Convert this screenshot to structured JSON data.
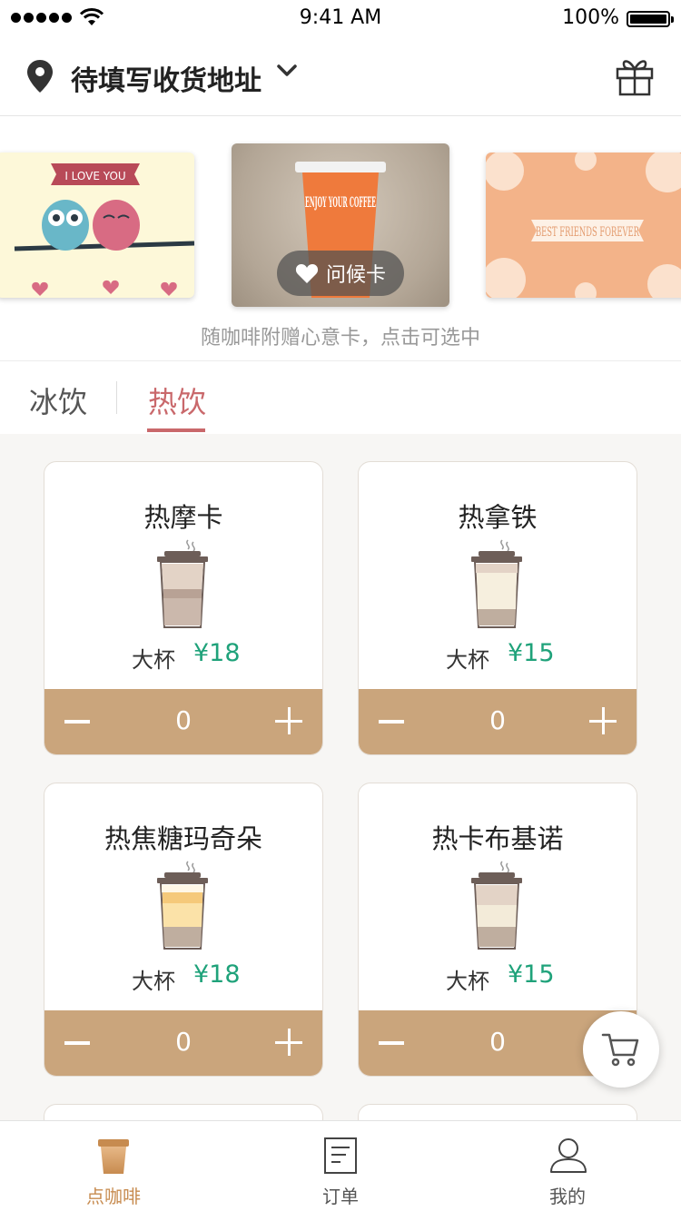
{
  "status_bar": {
    "time": "9:41 AM",
    "battery": "100%"
  },
  "header": {
    "address": "待填写收货地址"
  },
  "cards": {
    "items": [
      {
        "name": "owl-card",
        "text": "I LOVE YOU"
      },
      {
        "name": "coffee-card",
        "text": "ENJOY YOUR COFFEE",
        "badge": "问候卡"
      },
      {
        "name": "friends-card",
        "text": "BEST FRIENDS FOREVER"
      }
    ],
    "hint": "随咖啡附赠心意卡，点击可选中"
  },
  "tabs": {
    "items": [
      {
        "label": "冰饮"
      },
      {
        "label": "热饮",
        "active": true
      }
    ]
  },
  "products": [
    {
      "name": "热摩卡",
      "size": "大杯",
      "price": "¥18",
      "qty": "0"
    },
    {
      "name": "热拿铁",
      "size": "大杯",
      "price": "¥15",
      "qty": "0"
    },
    {
      "name": "热焦糖玛奇朵",
      "size": "大杯",
      "price": "¥18",
      "qty": "0"
    },
    {
      "name": "热卡布基诺",
      "size": "大杯",
      "price": "¥15",
      "qty": "0"
    }
  ],
  "tabbar": {
    "items": [
      {
        "label": "点咖啡",
        "icon": "coffee-cup-icon",
        "active": true
      },
      {
        "label": "订单",
        "icon": "order-list-icon"
      },
      {
        "label": "我的",
        "icon": "user-icon"
      }
    ]
  },
  "colors": {
    "accent": "#caa57c",
    "tab_active": "#c9686b",
    "price": "#1fa27a",
    "tabbar_active": "#c78b4f"
  }
}
